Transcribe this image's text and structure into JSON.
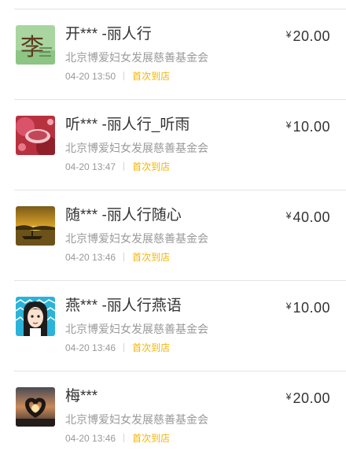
{
  "donations": [
    {
      "avatar": "li-character-avatar",
      "donor": "开*** -丽人行",
      "organization": "北京博爱妇女发展慈善基金会",
      "time": "04-20 13:50",
      "tag": "首次到店",
      "currency": "¥",
      "amount": "20.00"
    },
    {
      "avatar": "red-teacup-avatar",
      "donor": "听*** -丽人行_听雨",
      "organization": "北京博爱妇女发展慈善基金会",
      "time": "04-20 13:47",
      "tag": "首次到店",
      "currency": "¥",
      "amount": "10.00"
    },
    {
      "avatar": "sunset-boat-avatar",
      "donor": "随*** -丽人行随心",
      "organization": "北京博爱妇女发展慈善基金会",
      "time": "04-20 13:46",
      "tag": "首次到店",
      "currency": "¥",
      "amount": "40.00"
    },
    {
      "avatar": "cartoon-girl-avatar",
      "donor": "燕*** -丽人行燕语",
      "organization": "北京博爱妇女发展慈善基金会",
      "time": "04-20 13:46",
      "tag": "首次到店",
      "currency": "¥",
      "amount": "10.00"
    },
    {
      "avatar": "heart-hands-sunset-avatar",
      "donor": "梅***",
      "organization": "北京博爱妇女发展慈善基金会",
      "time": "04-20 13:46",
      "tag": "首次到店",
      "currency": "¥",
      "amount": "20.00"
    }
  ],
  "colors": {
    "tag": "#f5b400",
    "divider": "#e3e3e3",
    "secondary_text": "#9a9a9a"
  }
}
